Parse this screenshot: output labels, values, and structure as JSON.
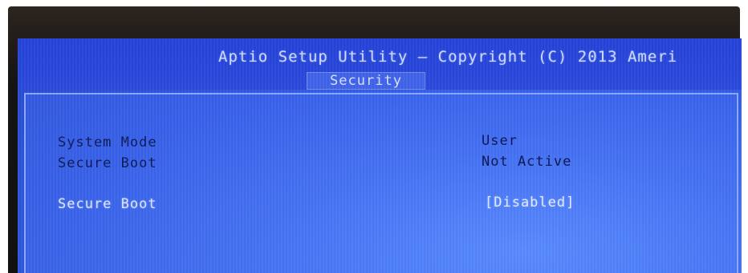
{
  "header": {
    "title": "Aptio Setup Utility – Copyright (C) 2013 Ameri",
    "active_tab": "Security"
  },
  "rows": [
    {
      "label": "System Mode",
      "value": "User",
      "editable": false
    },
    {
      "label": "Secure Boot",
      "value": "Not Active",
      "editable": false
    },
    {
      "label": "Secure Boot",
      "value": "[Disabled]",
      "editable": true
    }
  ],
  "colors": {
    "screen_blue": "#2f57e2",
    "highlight_text": "#dbe4ff",
    "static_text": "#0c1a55"
  }
}
